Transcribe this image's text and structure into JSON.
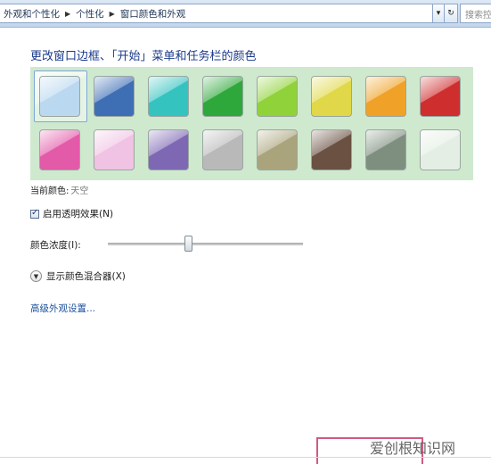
{
  "breadcrumb": {
    "items": [
      "外观和个性化",
      "个性化",
      "窗口颜色和外观"
    ],
    "sep": "▶"
  },
  "nav": {
    "dropdown_icon": "▾",
    "refresh_icon": "↻"
  },
  "search": {
    "placeholder": "搜索控"
  },
  "title": "更改窗口边框、「开始」菜单和任务栏的颜色",
  "swatches": {
    "selected_index": 0,
    "items": [
      {
        "color": "#bad8f0"
      },
      {
        "color": "#3e6fb5"
      },
      {
        "color": "#35c3c0"
      },
      {
        "color": "#2fa83b"
      },
      {
        "color": "#8fd23a"
      },
      {
        "color": "#e0d848"
      },
      {
        "color": "#efa227"
      },
      {
        "color": "#cf2e2e"
      },
      {
        "color": "#e35aa8"
      },
      {
        "color": "#f0c2e3"
      },
      {
        "color": "#7e68b4"
      },
      {
        "color": "#b9b9b9"
      },
      {
        "color": "#aaa47c"
      },
      {
        "color": "#6a5142"
      },
      {
        "color": "#7f8f7f"
      },
      {
        "color": "#e4eee4"
      }
    ]
  },
  "current_color": {
    "label": "当前颜色:",
    "value": "天空"
  },
  "transparency": {
    "label": "启用透明效果(N)",
    "checked": true
  },
  "intensity": {
    "label": "颜色浓度(I):",
    "value_fraction": 0.42
  },
  "mixer": {
    "label": "显示颜色混合器(X)"
  },
  "advanced_link": "高级外观设置...",
  "watermark": "爱创根知识网"
}
